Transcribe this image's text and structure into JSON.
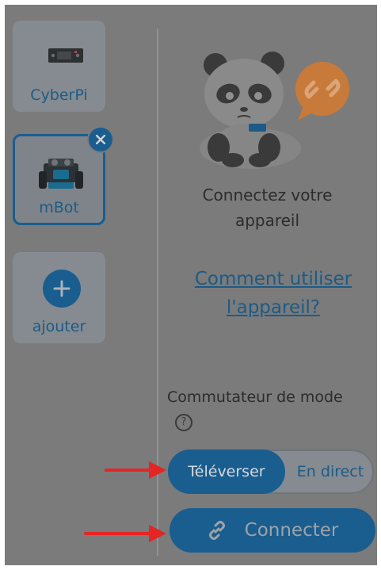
{
  "devices": [
    {
      "label": "CyberPi",
      "selected": false
    },
    {
      "label": "mBot",
      "selected": true
    }
  ],
  "add_label": "ajouter",
  "status": {
    "line1": "Connectez votre",
    "line2": "appareil"
  },
  "help_link": {
    "line1": "Comment utiliser",
    "line2": "l'appareil?"
  },
  "mode": {
    "label": "Commutateur de mode",
    "help_glyph": "?",
    "options": [
      "Téléverser",
      "En direct"
    ],
    "active": "Téléverser"
  },
  "connect_label": "Connecter",
  "icons": {
    "remove": "close-icon",
    "add": "plus-icon",
    "connect": "link-icon",
    "help": "question-circle-icon",
    "mascot": "panda-broken-link-icon"
  },
  "colors": {
    "accent": "#1a5d8f",
    "annotation": "#e52424",
    "badge": "#c87a3a"
  }
}
